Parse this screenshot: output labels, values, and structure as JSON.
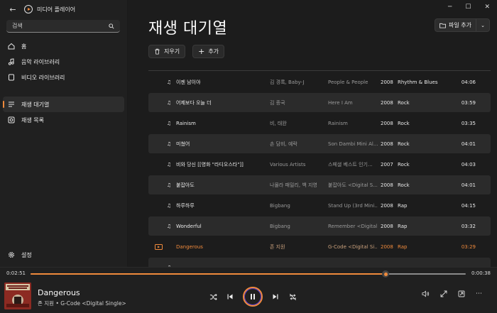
{
  "app": {
    "title": "미디어 플레이어",
    "accent": "#f08a3c"
  },
  "search": {
    "placeholder": "검색"
  },
  "nav": {
    "home": "홈",
    "music": "음악 라이브러리",
    "video": "비디오 라이브러리",
    "queue": "재생 대기열",
    "playlists": "재생 목록",
    "settings": "설정"
  },
  "page": {
    "title": "재생 대기열",
    "add_file": "파일 추가",
    "clear": "지우기",
    "add": "추가"
  },
  "tracks": [
    {
      "title": "이젠 남이야",
      "artist": "김 경록, Baby-J",
      "album": "People & People",
      "year": "2008",
      "genre": "Rhythm & Blues",
      "duration": "04:06"
    },
    {
      "title": "어제보다 오늘 더",
      "artist": "김 종국",
      "album": "Here I Am",
      "year": "2008",
      "genre": "Rock",
      "duration": "03:59"
    },
    {
      "title": "Rainism",
      "artist": "비, 태완",
      "album": "Rainism",
      "year": "2008",
      "genre": "Rock",
      "duration": "03:35"
    },
    {
      "title": "미쳤어",
      "artist": "손 담비, 예락",
      "album": "Son Dambi Mini Al...",
      "year": "2008",
      "genre": "Rock",
      "duration": "04:01"
    },
    {
      "title": "비와 당신 [[영화 \"라디오스타\"]]",
      "artist": "Various Artists",
      "album": "스페셜 베스트 인기...",
      "year": "2007",
      "genre": "Rock",
      "duration": "04:03"
    },
    {
      "title": "붙잡아도",
      "artist": "나몰라 패밀리, 백 지영",
      "album": "붙잡아도 <Digital S...",
      "year": "2008",
      "genre": "Rock",
      "duration": "04:01"
    },
    {
      "title": "하루하루",
      "artist": "Bigbang",
      "album": "Stand Up (3rd Mini...",
      "year": "2008",
      "genre": "Rap",
      "duration": "04:15"
    },
    {
      "title": "Wonderful",
      "artist": "Bigbang",
      "album": "Remember <Digital...",
      "year": "2008",
      "genre": "Rap",
      "duration": "03:32"
    },
    {
      "title": "Dangerous",
      "artist": "존 지원",
      "album": "G-Code <Digital Si...",
      "year": "2008",
      "genre": "Rap",
      "duration": "03:29",
      "playing": true
    },
    {
      "title": "",
      "artist": "",
      "album": "",
      "year": "",
      "genre": "",
      "duration": ""
    }
  ],
  "player": {
    "current_time": "0:02:51",
    "total_time": "0:00:38",
    "progress": 0.816,
    "now_title": "Dangerous",
    "now_subtitle": "존 지원 • G-Code <Digital Single>"
  }
}
